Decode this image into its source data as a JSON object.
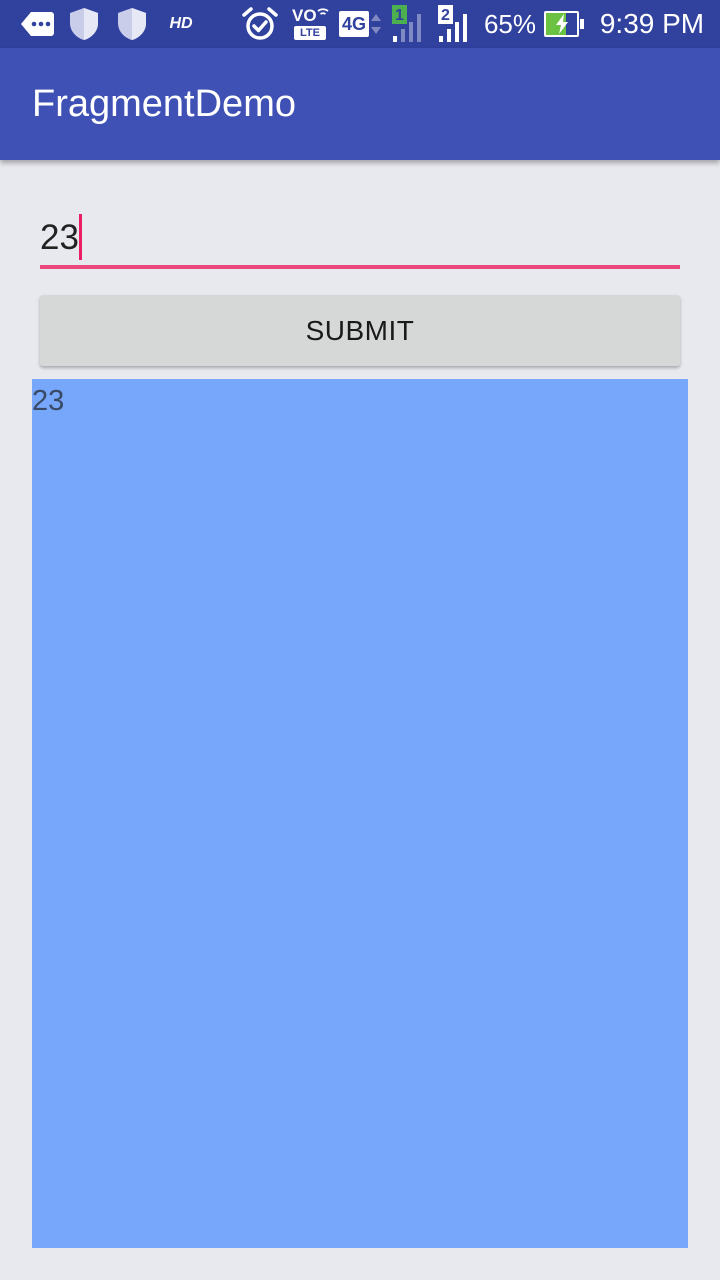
{
  "status_bar": {
    "hd_label": "HD",
    "volte_top": "VO",
    "volte_bottom": "LTE",
    "network_label": "4G",
    "sim1_label": "1",
    "sim2_label": "2",
    "battery_percent": "65%",
    "time": "9:39 PM",
    "icons": [
      "messages-icon",
      "shield-icon",
      "shield-icon",
      "hd-icon",
      "alarm-icon",
      "volte-icon",
      "4g-icon",
      "signal-sim1-icon",
      "signal-sim2-icon",
      "battery-charging-icon"
    ],
    "battery_level": 0.65
  },
  "app_bar": {
    "title": "FragmentDemo"
  },
  "form": {
    "input_value": "23",
    "submit_label": "SUBMIT"
  },
  "fragment": {
    "text": "23"
  },
  "colors": {
    "status_bar": "#30419e",
    "app_bar": "#3f51b5",
    "accent": "#e91e63",
    "fragment_background": "#76a7fa",
    "page_background": "#e8e9ee",
    "button_background": "#d6d7d7"
  }
}
